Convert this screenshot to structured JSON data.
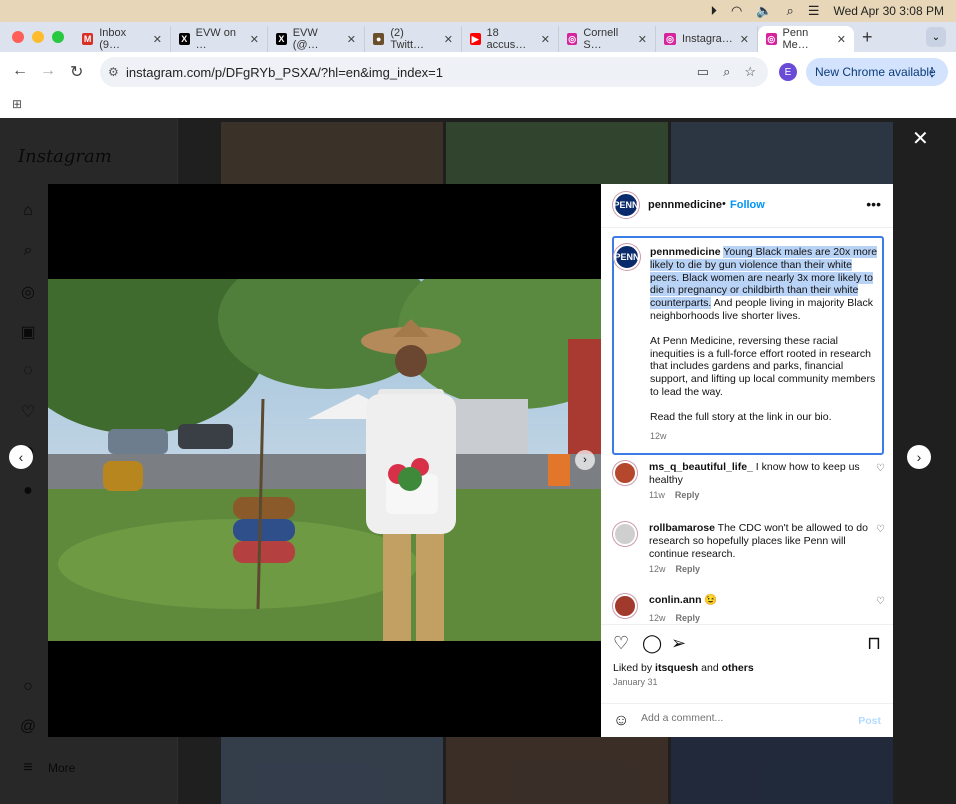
{
  "menubar": {
    "datetime": "Wed Apr 30  3:08 PM"
  },
  "tabs": [
    {
      "title": "Inbox (9…",
      "favicon": "M",
      "color": "#d93025"
    },
    {
      "title": "EVW on …",
      "favicon": "X",
      "color": "#000000"
    },
    {
      "title": "EVW (@…",
      "favicon": "X",
      "color": "#000000"
    },
    {
      "title": "(2) Twitt…",
      "favicon": "●",
      "color": "#6b4f2a"
    },
    {
      "title": "18 accus…",
      "favicon": "▶",
      "color": "#ff0000"
    },
    {
      "title": "Cornell S…",
      "favicon": "◎",
      "color": "#d6249f"
    },
    {
      "title": "Instagra…",
      "favicon": "◎",
      "color": "#d6249f"
    },
    {
      "title": "Penn Me…",
      "favicon": "◎",
      "color": "#d6249f"
    }
  ],
  "toolbar": {
    "url": "instagram.com/p/DFgRYb_PSXA/?hl=en&img_index=1",
    "profile_initial": "E",
    "update_label": "New Chrome available"
  },
  "instagram": {
    "logo": "Instagram",
    "more_label": "More"
  },
  "post": {
    "username": "pennmedicine",
    "follow_label": "Follow",
    "avatar_text": "PENN",
    "caption_highlight": "Young Black males are 20x more likely to die by gun violence than their white peers. Black women are nearly 3x more likely to die in pregnancy or childbirth than their white counterparts.",
    "caption_rest": " And people living in majority Black neighborhoods live shorter lives.",
    "caption_p2": "At Penn Medicine, reversing these racial inequities is a full-force effort rooted in research that includes gardens and parks, financial support, and lifting up local community members to lead the way.",
    "caption_p3": "Read the full story at the link in our bio.",
    "caption_age": "12w",
    "comments": [
      {
        "user": "ms_q_beautiful_life_",
        "text": " I know how to keep us healthy",
        "age": "11w",
        "reply": "Reply"
      },
      {
        "user": "rollbamarose",
        "text": " The CDC won't be allowed to do research so hopefully places like Penn will continue research.",
        "age": "12w",
        "reply": "Reply"
      },
      {
        "user": "conlin.ann",
        "text": " 😉",
        "age": "12w",
        "reply": "Reply"
      }
    ],
    "liked_prefix": "Liked by ",
    "liked_user": "itsquesh",
    "liked_mid": " and ",
    "liked_others": "others",
    "date": "January 31",
    "add_comment_placeholder": "Add a comment...",
    "post_label": "Post"
  }
}
